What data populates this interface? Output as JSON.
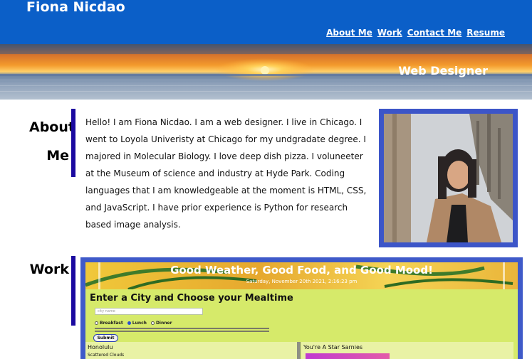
{
  "site": {
    "name": "Fiona Nicdao",
    "nav": [
      "About Me",
      "Work",
      "Contact Me",
      "Resume"
    ]
  },
  "hero": {
    "title": "Web Designer"
  },
  "about": {
    "heading_line1": "About",
    "heading_line2": "Me",
    "paragraph": "Hello! I am Fiona Nicdao. I am a web designer. I live in Chicago. I went to Loyola Univeristy at Chicago for my undgradate degree. I majored in Molecular Biology. I love deep dish pizza. I voluneeter at the Museum of science and industry at Hyde Park. Coding languages that I am knowledgeable at the moment is HTML, CSS, and JavaScript. I have prior experience is Python for research based image analysis."
  },
  "work": {
    "heading": "Work",
    "project": {
      "banner_title": "Good Weather, Good Food, and Good Mood!",
      "date": "Saturday, November 20th 2021, 2:16:23 pm",
      "prompt": "Enter a City and Choose your Mealtime",
      "input_placeholder": "city name",
      "meals": [
        "Breakfast",
        "Lunch",
        "Dinner"
      ],
      "selected_meal": "Lunch",
      "submit_label": "Submit",
      "city": "Honolulu",
      "weather": "Scattered Clouds",
      "restaurant": "You're A Star Sarnies"
    }
  },
  "colors": {
    "header_blue": "#0b5fc8",
    "accent_navy": "#1b0aa0",
    "frame_blue": "#3c55c8",
    "project_lime": "#d6ea6a"
  }
}
